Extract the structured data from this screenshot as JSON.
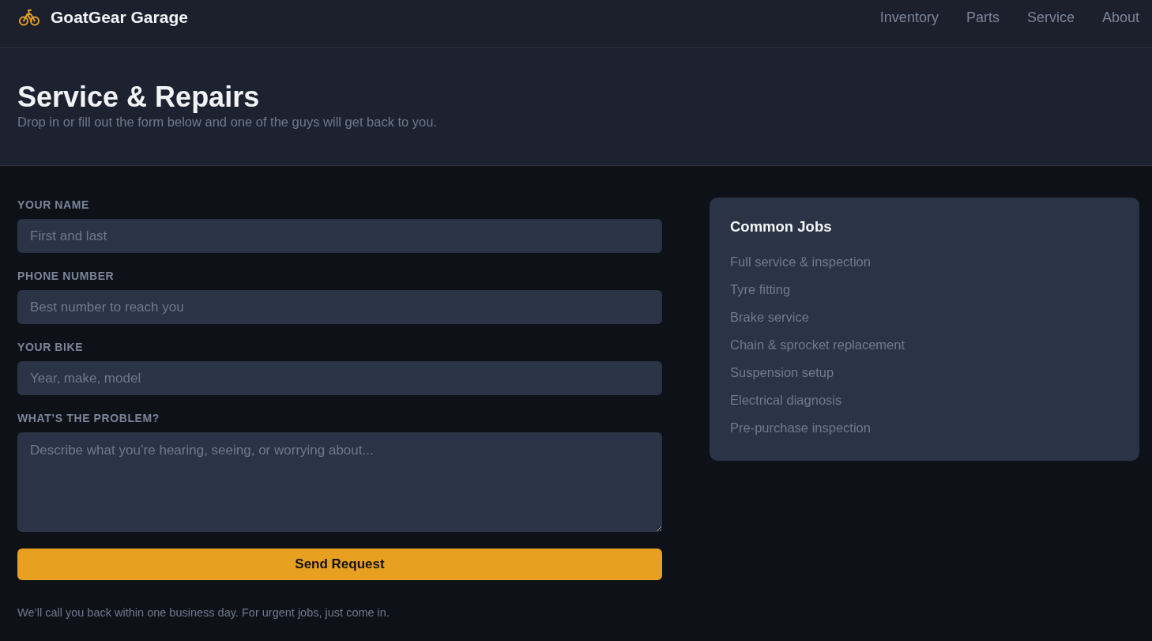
{
  "header": {
    "brand": "GoatGear Garage",
    "nav": [
      {
        "label": "Inventory"
      },
      {
        "label": "Parts"
      },
      {
        "label": "Service"
      },
      {
        "label": "About"
      }
    ]
  },
  "hero": {
    "title": "Service & Repairs",
    "subtitle": "Drop in or fill out the form below and one of the guys will get back to you."
  },
  "form": {
    "fields": [
      {
        "kind": "input",
        "label": "YOUR NAME",
        "placeholder": "First and last"
      },
      {
        "kind": "input",
        "label": "PHONE NUMBER",
        "placeholder": "Best number to reach you"
      },
      {
        "kind": "input",
        "label": "YOUR BIKE",
        "placeholder": "Year, make, model"
      },
      {
        "kind": "textarea",
        "label": "WHAT’S THE PROBLEM?",
        "placeholder": "Describe what you’re hearing, seeing, or worrying about..."
      }
    ],
    "submit": "Send Request",
    "note": "We’ll call you back within one business day. For urgent jobs, just come in."
  },
  "common_jobs": {
    "title": "Common Jobs",
    "items": [
      "Full service & inspection",
      "Tyre fitting",
      "Brake service",
      "Chain & sprocket replacement",
      "Suspension setup",
      "Electrical diagnosis",
      "Pre-purchase inspection"
    ]
  }
}
